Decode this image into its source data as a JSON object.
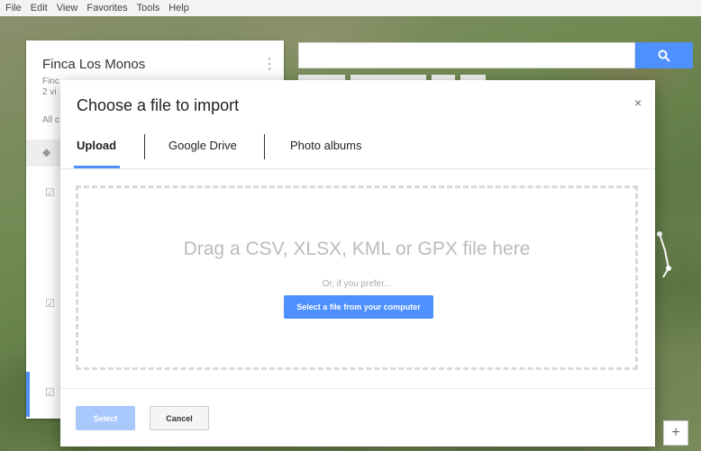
{
  "menu": [
    "File",
    "Edit",
    "View",
    "Favorites",
    "Tools",
    "Help"
  ],
  "left_panel": {
    "title": "Finca Los Monos",
    "subtitle_1": "Finc",
    "subtitle_2": "2 vi",
    "all_label": "All c",
    "more_icon": "⋮"
  },
  "search": {
    "placeholder": "",
    "button_icon": "search-icon"
  },
  "dialog": {
    "title": "Choose a file to import",
    "close": "×",
    "tabs": [
      {
        "label": "Upload",
        "active": true
      },
      {
        "label": "Google Drive",
        "active": false
      },
      {
        "label": "Photo albums",
        "active": false
      }
    ],
    "drop_text": "Drag a CSV, XLSX, KML or GPX file here",
    "or_text": "Or, if you prefer...",
    "select_file_button": "Select a file from your computer",
    "select_button": "Select",
    "cancel_button": "Cancel"
  },
  "map": {
    "zoom_in": "+"
  },
  "colors": {
    "accent": "#4d90fe",
    "disabled_accent": "#a9c8fb"
  }
}
